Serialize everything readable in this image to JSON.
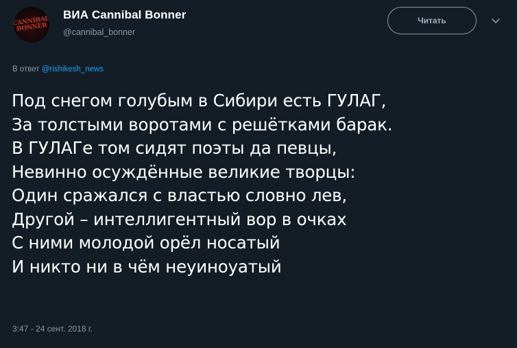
{
  "author": {
    "display_name": "ВИА Cannibal Bonner",
    "handle": "@cannibal_bonner",
    "avatar_logo_line1": "CANNIBAL",
    "avatar_logo_line2": "BONNER"
  },
  "follow_button_label": "Читать",
  "reply_to": {
    "prefix": "В ответ",
    "mention": "@rishikesh_news"
  },
  "tweet_lines": [
    "Под снегом голубым в Сибири есть ГУЛАГ,",
    "За толстыми воротами с решётками барак.",
    "В ГУЛАГе том сидят поэты да певцы,",
    "Невинно осуждённые великие творцы:",
    "Один сражался с властью словно лев,",
    "Другой – интеллигентный вор в очках",
    "С ними молодой орёл носатый",
    "И никто ни в чём неуиноуатый"
  ],
  "timestamp": "3:47 - 24 сент. 2018 г.",
  "icons": {
    "menu": "chevron-down-icon"
  },
  "colors": {
    "background": "#141d26",
    "text": "#ffffff",
    "muted": "#8899a6",
    "link": "#1da1f2",
    "logo": "#c0392b"
  }
}
